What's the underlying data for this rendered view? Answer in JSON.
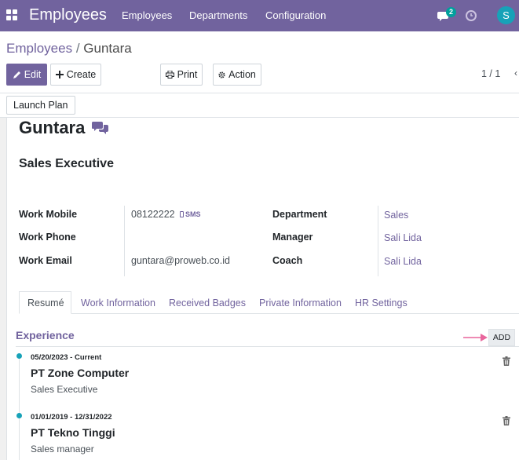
{
  "navbar": {
    "brand": "Employees",
    "menu": [
      "Employees",
      "Departments",
      "Configuration"
    ],
    "chat_count": "2",
    "avatar_letter": "S",
    "color": "#71639e"
  },
  "breadcrumb": {
    "parent": "Employees",
    "current": "Guntara"
  },
  "toolbar": {
    "edit": "Edit",
    "create": "Create",
    "print": "Print",
    "action": "Action",
    "pager": "1 / 1"
  },
  "status": {
    "launch_plan": "Launch Plan"
  },
  "employee": {
    "name": "Guntara",
    "job_title": "Sales Executive",
    "fields": {
      "work_mobile_label": "Work Mobile",
      "work_mobile": "08122222",
      "sms": "SMS",
      "work_phone_label": "Work Phone",
      "work_phone": "",
      "work_email_label": "Work Email",
      "work_email": "guntara@proweb.co.id",
      "department_label": "Department",
      "department": "Sales",
      "manager_label": "Manager",
      "manager": "Sali Lida",
      "coach_label": "Coach",
      "coach": "Sali Lida"
    }
  },
  "tabs": [
    "Resumé",
    "Work Information",
    "Received Badges",
    "Private Information",
    "HR Settings"
  ],
  "resume": {
    "section_title": "Experience",
    "add_label": "ADD",
    "items": [
      {
        "dates": "05/20/2023 - Current",
        "company": "PT Zone Computer",
        "role": "Sales Executive"
      },
      {
        "dates": "01/01/2019 - 12/31/2022",
        "company": "PT Tekno Tinggi",
        "role": "Sales manager"
      }
    ]
  },
  "colors": {
    "accent": "#71639e",
    "timeline_dot": "#17a2b8",
    "annotation_arrow": "#e8659c"
  },
  "icons": [
    "apps-icon",
    "chat-icon",
    "clock-icon",
    "pencil-icon",
    "plus-icon",
    "print-icon",
    "gear-icon",
    "mobile-icon",
    "trash-icon"
  ]
}
